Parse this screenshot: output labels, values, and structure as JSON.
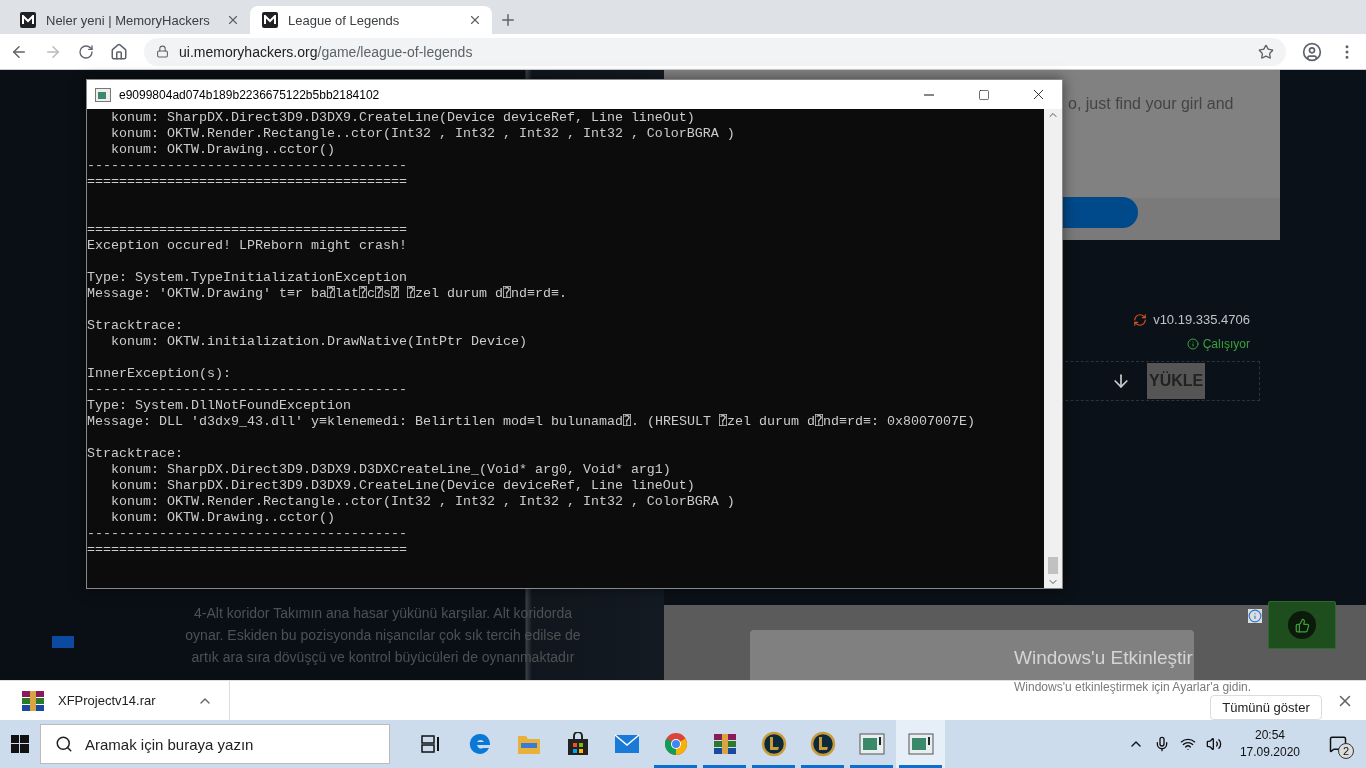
{
  "browser": {
    "tabs": [
      {
        "title": "Neler yeni | MemoryHackers",
        "selected": false
      },
      {
        "title": "League of Legends",
        "selected": true
      }
    ],
    "url": {
      "host": "ui.memoryhackers.org",
      "path": "/game/league-of-legends"
    }
  },
  "page": {
    "card_text": "o, just find your girl and",
    "version": "v10.19.335.4706",
    "status": "Çalışıyor",
    "install_button": "YÜKLE",
    "paragraph": "4-Alt koridor Takımın ana hasar yükünü karşılar. Alt koridorda oynar. Eskiden bu pozisyonda nişancılar çok sık tercih edilse de artık ara sıra dövüşçü ve kontrol büyücüleri de oynanmaktadır"
  },
  "console": {
    "title": "e9099804ad074b189b2236675122b5bb2184102",
    "lines": [
      {
        "kind": "text",
        "text": "   konum: SharpDX.Direct3D9.D3DX9.CreateLine(Device deviceRef, Line lineOut)"
      },
      {
        "kind": "text",
        "text": "   konum: OKTW.Render.Rectangle..ctor(Int32 , Int32 , Int32 , Int32 , ColorBGRA )"
      },
      {
        "kind": "text",
        "text": "   konum: OKTW.Drawing..cctor()"
      },
      {
        "kind": "text",
        "text": "----------------------------------------"
      },
      {
        "kind": "text",
        "text": "========================================"
      },
      {
        "kind": "blank"
      },
      {
        "kind": "blank"
      },
      {
        "kind": "text",
        "text": "========================================"
      },
      {
        "kind": "text",
        "text": "Exception occured! LPReborn might crash!"
      },
      {
        "kind": "blank"
      },
      {
        "kind": "text",
        "text": "Type: System.TypeInitializationException"
      },
      {
        "kind": "text",
        "text": "Message: 'OKTW.Drawing' t≡r ba⍰lat⍰c⍰s⍰ ⍰zel durum d⍰nd≡rd≡."
      },
      {
        "kind": "blank"
      },
      {
        "kind": "text",
        "text": "Stracktrace:"
      },
      {
        "kind": "text",
        "text": "   konum: OKTW.initialization.DrawNative(IntPtr Device)"
      },
      {
        "kind": "blank"
      },
      {
        "kind": "text",
        "text": "InnerException(s):"
      },
      {
        "kind": "text",
        "text": "----------------------------------------"
      },
      {
        "kind": "text",
        "text": "Type: System.DllNotFoundException"
      },
      {
        "kind": "text",
        "text": "Message: DLL 'd3dx9_43.dll' y≡klenemedi: Belirtilen mod≡l bulunamad⍰. (HRESULT ⍰zel durum d⍰nd≡rd≡: 0x8007007E)"
      },
      {
        "kind": "blank"
      },
      {
        "kind": "text",
        "text": "Stracktrace:"
      },
      {
        "kind": "text",
        "text": "   konum: SharpDX.Direct3D9.D3DX9.D3DXCreateLine_(Void* arg0, Void* arg1)"
      },
      {
        "kind": "text",
        "text": "   konum: SharpDX.Direct3D9.D3DX9.CreateLine(Device deviceRef, Line lineOut)"
      },
      {
        "kind": "text",
        "text": "   konum: OKTW.Render.Rectangle..ctor(Int32 , Int32 , Int32 , Int32 , ColorBGRA )"
      },
      {
        "kind": "text",
        "text": "   konum: OKTW.Drawing..cctor()"
      },
      {
        "kind": "text",
        "text": "----------------------------------------"
      },
      {
        "kind": "text",
        "text": "========================================"
      }
    ]
  },
  "downloads": {
    "file": "XFProjectv14.rar",
    "show_all": "Tümünü göster"
  },
  "activation": {
    "title": "Windows'u Etkinleştir",
    "hint": "Windows'u etkinleştirmek için Ayarlar'a gidin."
  },
  "taskbar": {
    "search_placeholder": "Aramak için buraya yazın",
    "apps": [
      {
        "kind": "taskview",
        "running": false,
        "selected": false
      },
      {
        "kind": "edge",
        "running": false,
        "selected": false
      },
      {
        "kind": "explorer",
        "running": false,
        "selected": false
      },
      {
        "kind": "store",
        "running": false,
        "selected": false
      },
      {
        "kind": "mail",
        "running": false,
        "selected": false
      },
      {
        "kind": "chrome",
        "running": true,
        "selected": false
      },
      {
        "kind": "winrar",
        "running": true,
        "selected": false
      },
      {
        "kind": "league",
        "running": true,
        "selected": false
      },
      {
        "kind": "league",
        "running": true,
        "selected": false
      },
      {
        "kind": "console",
        "running": true,
        "selected": false
      },
      {
        "kind": "console",
        "running": true,
        "selected": true
      }
    ],
    "time": "20:54",
    "date": "17.09.2020",
    "notifications": "2"
  }
}
